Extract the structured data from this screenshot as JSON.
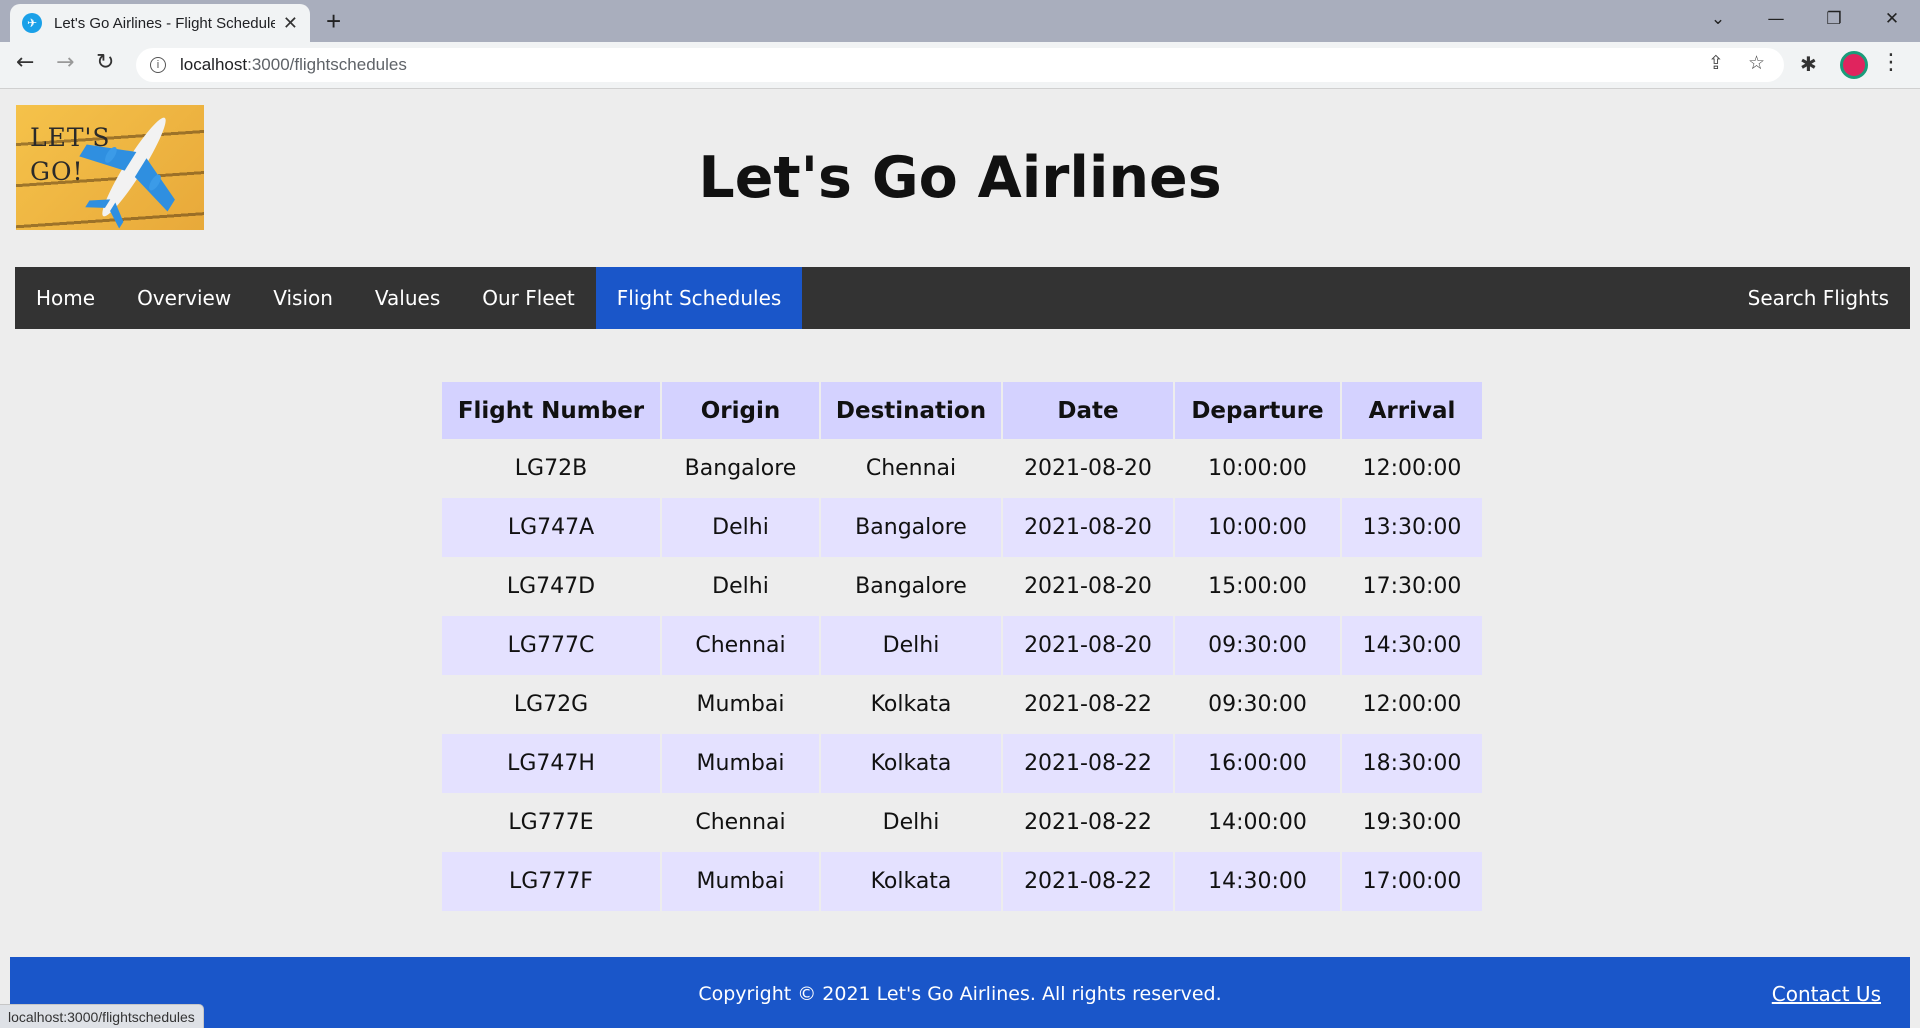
{
  "browser": {
    "tab_title": "Let's Go Airlines - Flight Schedules",
    "new_tab_icon": "plus-icon",
    "url_host": "localhost",
    "url_path": ":3000/flightschedules",
    "status_text": "localhost:3000/flightschedules"
  },
  "header": {
    "logo_text_line1": "LET'S",
    "logo_text_line2": "GO!",
    "site_title": "Let's Go Airlines"
  },
  "nav": {
    "items": [
      {
        "label": "Home"
      },
      {
        "label": "Overview"
      },
      {
        "label": "Vision"
      },
      {
        "label": "Values"
      },
      {
        "label": "Our Fleet"
      },
      {
        "label": "Flight Schedules"
      }
    ],
    "active": "Flight Schedules",
    "search_label": "Search Flights",
    "active_color": "#1a56c9"
  },
  "schedule": {
    "columns": [
      "Flight Number",
      "Origin",
      "Destination",
      "Date",
      "Departure",
      "Arrival"
    ],
    "rows": [
      [
        "LG72B",
        "Bangalore",
        "Chennai",
        "2021-08-20",
        "10:00:00",
        "12:00:00"
      ],
      [
        "LG747A",
        "Delhi",
        "Bangalore",
        "2021-08-20",
        "10:00:00",
        "13:30:00"
      ],
      [
        "LG747D",
        "Delhi",
        "Bangalore",
        "2021-08-20",
        "15:00:00",
        "17:30:00"
      ],
      [
        "LG777C",
        "Chennai",
        "Delhi",
        "2021-08-20",
        "09:30:00",
        "14:30:00"
      ],
      [
        "LG72G",
        "Mumbai",
        "Kolkata",
        "2021-08-22",
        "09:30:00",
        "12:00:00"
      ],
      [
        "LG747H",
        "Mumbai",
        "Kolkata",
        "2021-08-22",
        "16:00:00",
        "18:30:00"
      ],
      [
        "LG777E",
        "Chennai",
        "Delhi",
        "2021-08-22",
        "14:00:00",
        "19:30:00"
      ],
      [
        "LG777F",
        "Mumbai",
        "Kolkata",
        "2021-08-22",
        "14:30:00",
        "17:00:00"
      ]
    ]
  },
  "footer": {
    "copyright": "Copyright © 2021 Let's Go Airlines. All rights reserved.",
    "contact_label": "Contact Us"
  }
}
